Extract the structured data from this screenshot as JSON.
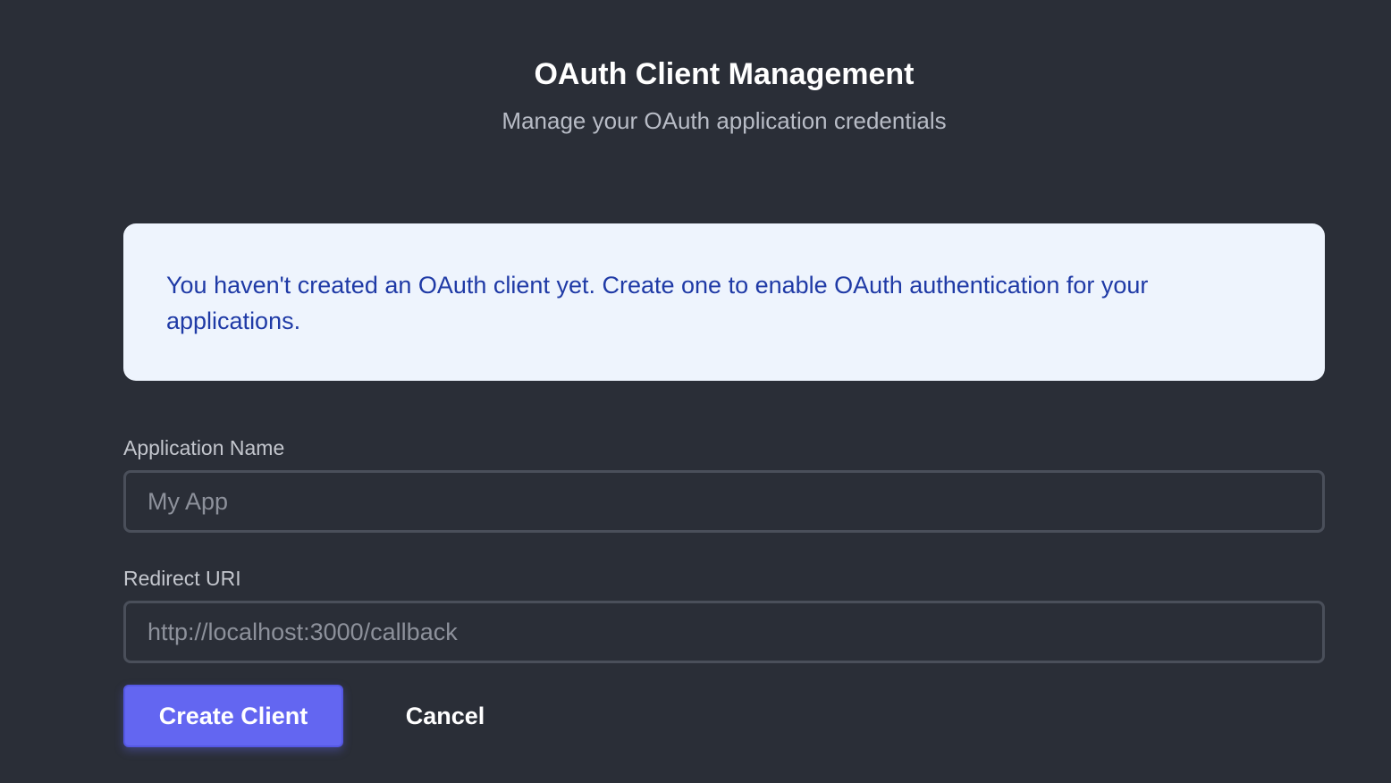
{
  "header": {
    "title": "OAuth Client Management",
    "subtitle": "Manage your OAuth application credentials"
  },
  "notice": {
    "message": "You haven't created an OAuth client yet. Create one to enable OAuth authentication for your applications."
  },
  "form": {
    "app_name": {
      "label": "Application Name",
      "value": "",
      "placeholder": "My App"
    },
    "redirect_uri": {
      "label": "Redirect URI",
      "value": "",
      "placeholder": "http://localhost:3000/callback"
    },
    "create_label": "Create Client",
    "cancel_label": "Cancel"
  },
  "colors": {
    "background": "#2a2e37",
    "notice_background": "#eef4fd",
    "notice_text": "#1f3aa6",
    "primary_button": "#6366f1"
  }
}
